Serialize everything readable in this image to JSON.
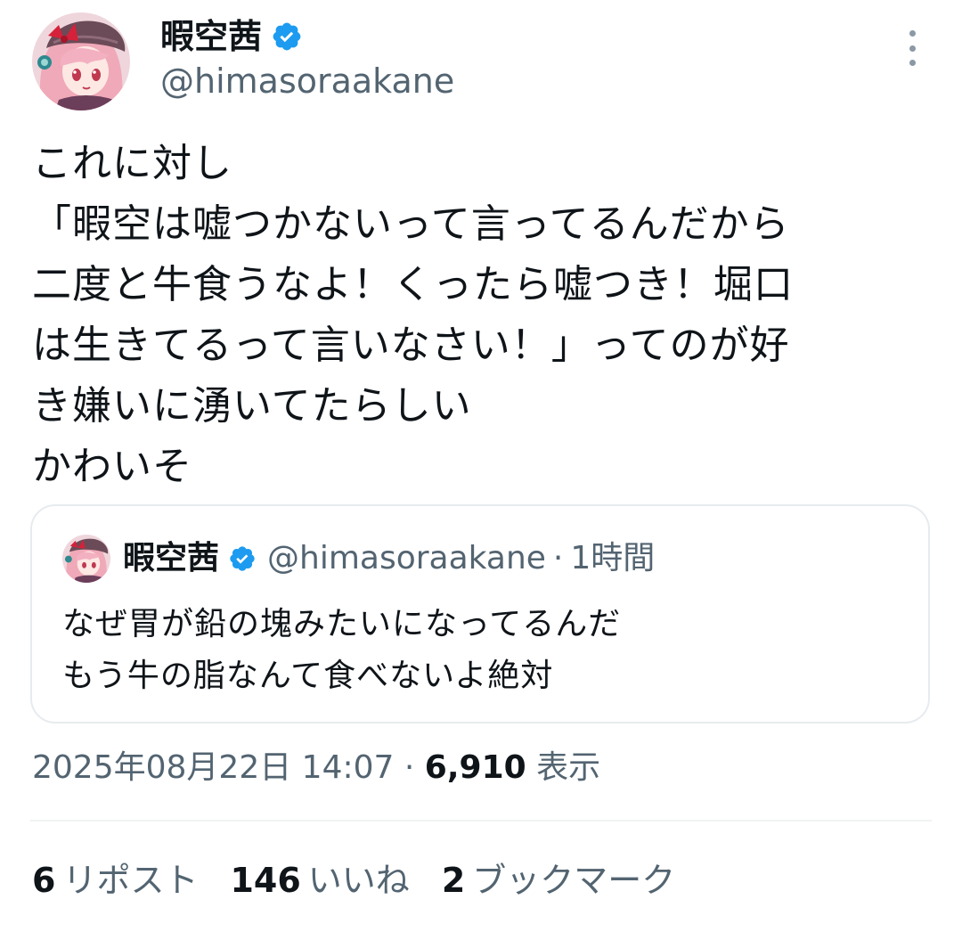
{
  "author": {
    "display_name": "暇空茜",
    "handle": "@himasoraakane",
    "verified_color": "#1d9bf0"
  },
  "menu": {
    "icon": "more-vertical-icon"
  },
  "tweet": {
    "lines": [
      "これに対し",
      "「暇空は嘘つかないって言ってるんだから",
      "二度と牛食うなよ！くったら嘘つき！堀口",
      "は生きてるって言いなさい！」ってのが好",
      "き嫌いに湧いてたらしい",
      "かわいそ"
    ]
  },
  "quote": {
    "display_name": "暇空茜",
    "handle": "@himasoraakane",
    "separator": "·",
    "time": "1時間",
    "lines": [
      "なぜ胃が鉛の塊みたいになってるんだ",
      "もう牛の脂なんて食べないよ絶対"
    ]
  },
  "meta": {
    "datetime": "2025年08月22日 14:07",
    "separator": "·",
    "views": "6,910",
    "views_label": "表示"
  },
  "stats": [
    {
      "count": "6",
      "label": "リポスト"
    },
    {
      "count": "146",
      "label": "いいね"
    },
    {
      "count": "2",
      "label": "ブックマーク"
    }
  ]
}
